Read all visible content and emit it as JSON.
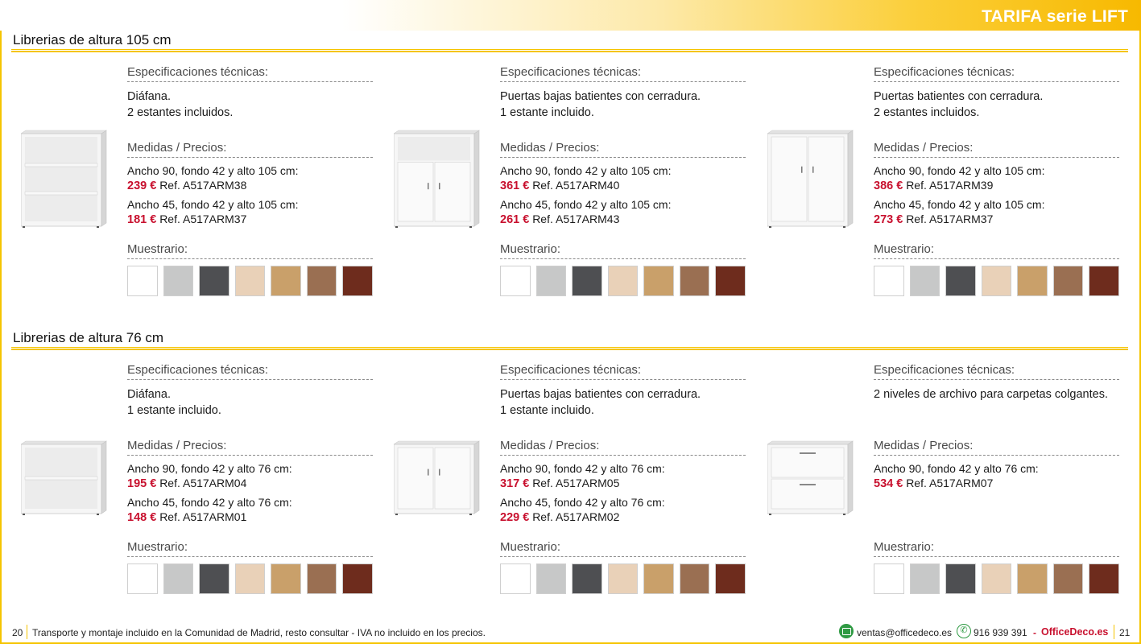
{
  "header": {
    "title": "TARIFA serie LIFT"
  },
  "sections": [
    {
      "title": "Librerias de altura 105 cm",
      "products": [
        {
          "spec_heading": "Especificaciones técnicas:",
          "spec_lines": [
            "Diáfana.",
            "2 estantes incluidos."
          ],
          "prices_heading": "Medidas / Precios:",
          "prices": [
            {
              "dims": "Ancho 90, fondo 42 y alto 105 cm:",
              "price": "239 €",
              "ref": "Ref. A517ARM38"
            },
            {
              "dims": "Ancho 45, fondo 42 y alto 105 cm:",
              "price": "181 €",
              "ref": "Ref. A517ARM37"
            }
          ],
          "swatch_heading": "Muestrario:",
          "image": "open-shelf-tall"
        },
        {
          "spec_heading": "Especificaciones técnicas:",
          "spec_lines": [
            "Puertas bajas batientes con cerradura.",
            "1 estante incluido."
          ],
          "prices_heading": "Medidas / Precios:",
          "prices": [
            {
              "dims": "Ancho 90, fondo 42 y alto 105 cm:",
              "price": "361 €",
              "ref": "Ref. A517ARM40"
            },
            {
              "dims": "Ancho 45, fondo 42 y alto 105 cm:",
              "price": "261 €",
              "ref": "Ref. A517ARM43"
            }
          ],
          "swatch_heading": "Muestrario:",
          "image": "low-doors-tall"
        },
        {
          "spec_heading": "Especificaciones técnicas:",
          "spec_lines": [
            "Puertas batientes con cerradura.",
            "2 estantes incluidos."
          ],
          "prices_heading": "Medidas / Precios:",
          "prices": [
            {
              "dims": "Ancho 90, fondo 42 y alto 105 cm:",
              "price": "386 €",
              "ref": "Ref. A517ARM39"
            },
            {
              "dims": "Ancho 45, fondo 42 y alto 105 cm:",
              "price": "273 €",
              "ref": "Ref. A517ARM37"
            }
          ],
          "swatch_heading": "Muestrario:",
          "image": "full-doors-tall"
        }
      ]
    },
    {
      "title": "Librerias de altura 76 cm",
      "products": [
        {
          "spec_heading": "Especificaciones técnicas:",
          "spec_lines": [
            "Diáfana.",
            "1 estante incluido."
          ],
          "prices_heading": "Medidas / Precios:",
          "prices": [
            {
              "dims": "Ancho 90, fondo 42 y alto 76 cm:",
              "price": "195 €",
              "ref": "Ref. A517ARM04"
            },
            {
              "dims": "Ancho 45, fondo 42 y alto 76 cm:",
              "price": "148 €",
              "ref": "Ref. A517ARM01"
            }
          ],
          "swatch_heading": "Muestrario:",
          "image": "open-shelf-low"
        },
        {
          "spec_heading": "Especificaciones técnicas:",
          "spec_lines": [
            "Puertas bajas batientes con cerradura.",
            "1 estante incluido."
          ],
          "prices_heading": "Medidas / Precios:",
          "prices": [
            {
              "dims": "Ancho 90, fondo 42 y alto 76 cm:",
              "price": "317 €",
              "ref": "Ref. A517ARM05"
            },
            {
              "dims": "Ancho 45, fondo 42 y alto 76 cm:",
              "price": "229 €",
              "ref": "Ref. A517ARM02"
            }
          ],
          "swatch_heading": "Muestrario:",
          "image": "doors-low"
        },
        {
          "spec_heading": "Especificaciones técnicas:",
          "spec_lines": [
            "2 niveles de archivo para carpetas colgantes."
          ],
          "prices_heading": "Medidas / Precios:",
          "prices": [
            {
              "dims": "Ancho 90, fondo 42 y alto 76 cm:",
              "price": "534 €",
              "ref": "Ref. A517ARM07"
            }
          ],
          "swatch_heading": "Muestrario:",
          "image": "filing-drawers-low"
        }
      ]
    }
  ],
  "swatch_colors": [
    "#ffffff",
    "#c7c8c8",
    "#4e4f52",
    "#e9d1b8",
    "#c9a06a",
    "#9a6f52",
    "#6e2c1d"
  ],
  "footer": {
    "page_left": "20",
    "note": "Transporte y montaje incluido en la Comunidad de Madrid, resto consultar - IVA no incluido en los precios.",
    "email": "ventas@officedeco.es",
    "phone": "916 939 391",
    "dash": "-",
    "brand": "OfficeDeco.es",
    "page_right": "21"
  },
  "colors": {
    "accent": "#f5c400",
    "price": "#c8102e",
    "footer_icon": "#2f9a43"
  }
}
